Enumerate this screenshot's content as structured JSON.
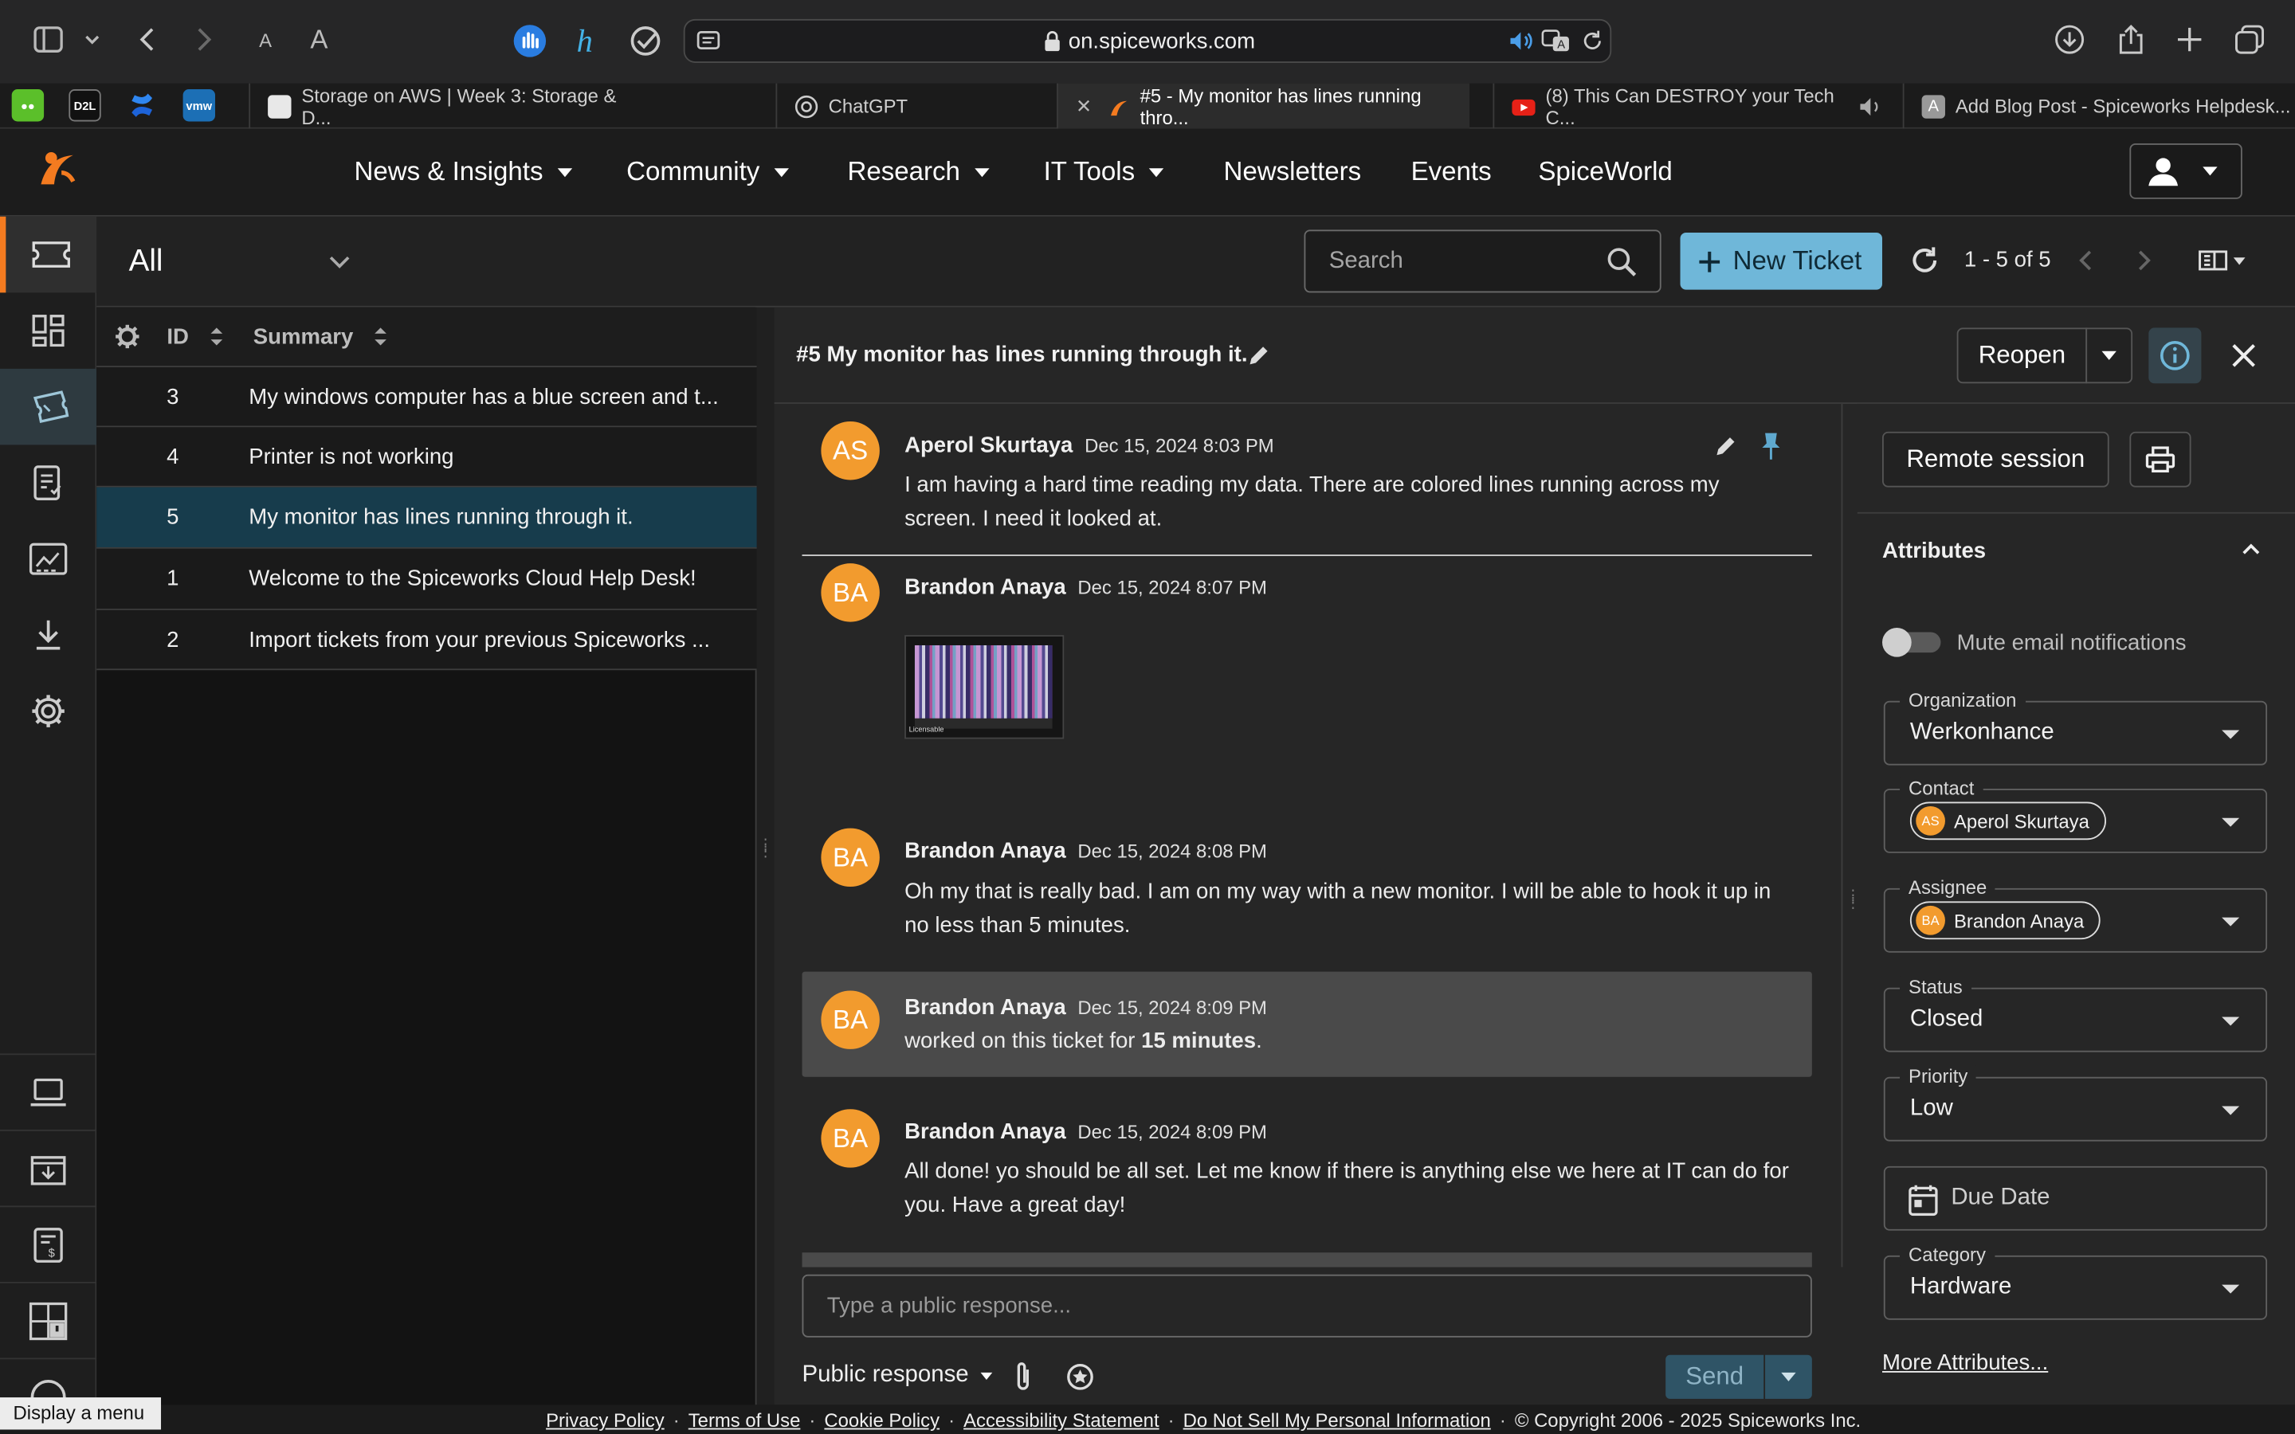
{
  "browser": {
    "url": "on.spiceworks.com",
    "font_small": "A",
    "font_large": "A"
  },
  "pinned_tabs": [
    {
      "label": "",
      "color": "#5bbf2a",
      "icon": "duolingo-icon"
    },
    {
      "label": "D2L",
      "color": "#1f1f1f",
      "icon": "d2l-icon"
    },
    {
      "label": "",
      "color": "#1d63d9",
      "icon": "confluence-icon"
    },
    {
      "label": "vmw",
      "color": "#1c6fb5",
      "icon": "vmware-icon"
    }
  ],
  "tabs": [
    {
      "title": "Storage on AWS | Week 3: Storage & D...",
      "active": false
    },
    {
      "title": "ChatGPT",
      "active": false
    },
    {
      "title": "#5 - My monitor has lines running thro...",
      "active": true
    },
    {
      "title": "(8) This Can DESTROY your Tech C...",
      "active": false
    },
    {
      "title": "Add Blog Post - Spiceworks Helpdesk...",
      "active": false
    }
  ],
  "site_nav": [
    {
      "label": "News & Insights",
      "dropdown": true
    },
    {
      "label": "Community",
      "dropdown": true
    },
    {
      "label": "Research",
      "dropdown": true
    },
    {
      "label": "IT Tools",
      "dropdown": true
    },
    {
      "label": "Newsletters",
      "dropdown": false
    },
    {
      "label": "Events",
      "dropdown": false
    },
    {
      "label": "SpiceWorld",
      "dropdown": false
    }
  ],
  "filter": {
    "view": "All",
    "search_placeholder": "Search",
    "new_ticket": "New Ticket",
    "pagination": "1 - 5 of 5"
  },
  "list": {
    "col_id": "ID",
    "col_summary": "Summary",
    "rows": [
      {
        "id": "3",
        "summary": "My windows computer has a blue screen and t...",
        "selected": false
      },
      {
        "id": "4",
        "summary": "Printer is not working",
        "selected": false
      },
      {
        "id": "5",
        "summary": "My monitor has lines running through it.",
        "selected": true
      },
      {
        "id": "1",
        "summary": "Welcome to the Spiceworks Cloud Help Desk!",
        "selected": false
      },
      {
        "id": "2",
        "summary": "Import tickets from your previous Spiceworks ...",
        "selected": false
      }
    ]
  },
  "ticket": {
    "title": "#5 My monitor has lines running through it.",
    "reopen": "Reopen",
    "messages": [
      {
        "initials": "AS",
        "name": "Aperol Skurtaya",
        "time": "Dec 15, 2024 8:03 PM",
        "text": "I am having a hard time reading my data. There are colored lines running across my screen. I need it looked at."
      },
      {
        "initials": "BA",
        "name": "Brandon Anaya",
        "time": "Dec 15, 2024 8:07 PM",
        "text": ""
      },
      {
        "initials": "BA",
        "name": "Brandon Anaya",
        "time": "Dec 15, 2024 8:08 PM",
        "text": "Oh my that is really bad. I am on my way with a new monitor. I will be able to hook it up in no less than 5 minutes."
      },
      {
        "initials": "BA",
        "name": "Brandon Anaya",
        "time": "Dec 15, 2024 8:09 PM",
        "text_prefix": "worked on this ticket for ",
        "text_bold": "15 minutes",
        "text_suffix": "."
      },
      {
        "initials": "BA",
        "name": "Brandon Anaya",
        "time": "Dec 15, 2024 8:09 PM",
        "text": "All done! yo should be all set. Let me know if there is anything else we here at IT can do for you. Have a great day!"
      }
    ],
    "attachment_caption": "Licensable",
    "reply_placeholder": "Type a public response...",
    "response_type": "Public response",
    "send": "Send"
  },
  "sidebar": {
    "remote_session": "Remote session",
    "attributes": "Attributes",
    "mute": "Mute email notifications",
    "organization_label": "Organization",
    "organization": "Werkonhance",
    "contact_label": "Contact",
    "contact_initials": "AS",
    "contact": "Aperol Skurtaya",
    "assignee_label": "Assignee",
    "assignee_initials": "BA",
    "assignee": "Brandon Anaya",
    "status_label": "Status",
    "status": "Closed",
    "priority_label": "Priority",
    "priority": "Low",
    "due_date": "Due Date",
    "category_label": "Category",
    "category": "Hardware",
    "more": "More Attributes..."
  },
  "footer": {
    "links": [
      "Privacy Policy",
      "Terms of Use",
      "Cookie Policy",
      "Accessibility Statement",
      "Do Not Sell My Personal Information"
    ],
    "copyright": "© Copyright 2006 - 2025 Spiceworks Inc."
  },
  "tooltip": "Display a menu",
  "colors": {
    "accent": "#6fb7d9",
    "avatar": "#f29b2e",
    "selected_row": "#173c4c",
    "brand": "#f47b20"
  }
}
